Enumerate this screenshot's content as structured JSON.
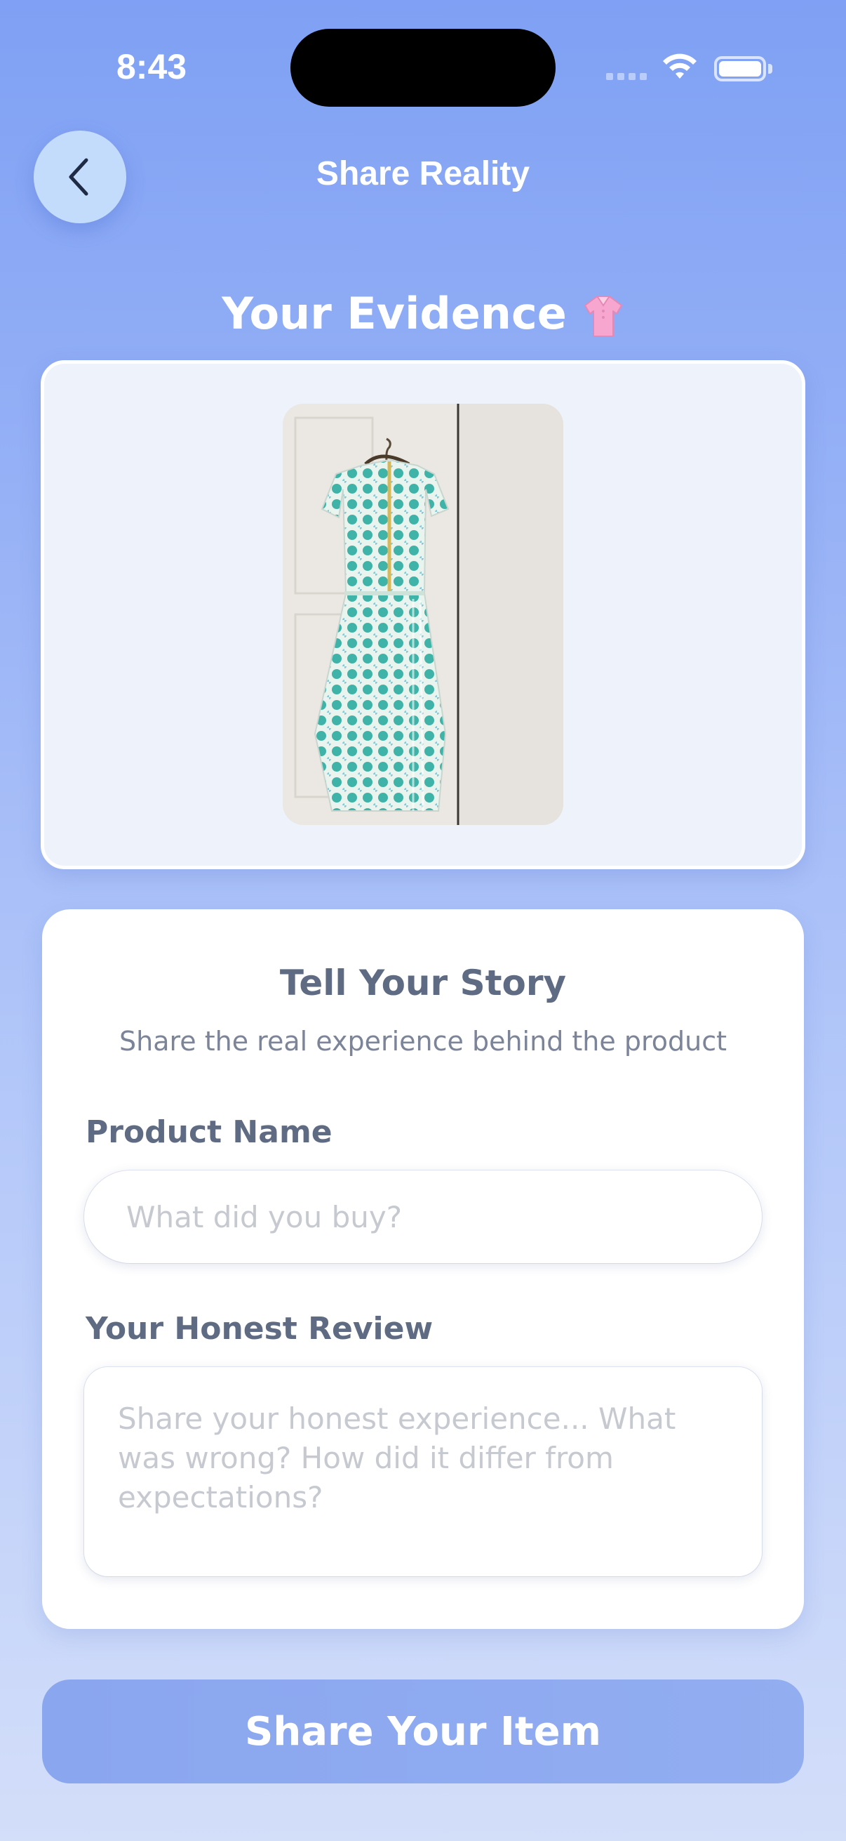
{
  "status_bar": {
    "time": "8:43",
    "icons": [
      "signal-icon",
      "wifi-icon",
      "battery-icon"
    ]
  },
  "header": {
    "title": "Share Reality",
    "back_icon": "chevron-left-icon"
  },
  "evidence": {
    "title": "Your Evidence",
    "title_icon": "shirt-icon",
    "photo_icon": "dress-photo"
  },
  "story": {
    "title": "Tell Your Story",
    "subtitle": "Share the real experience behind the product",
    "product_name_label": "Product Name",
    "product_name_placeholder": "What did you buy?",
    "product_name_value": "",
    "review_label": "Your Honest Review",
    "review_placeholder": "Share your honest experience... What was wrong? How did it differ from expectations?",
    "review_value": ""
  },
  "action": {
    "share_label": "Share Your Item"
  },
  "colors": {
    "background_top": "#7fa0f4",
    "background_bottom": "#d3def9",
    "text_primary": "#5f6b83",
    "button": "#8aa6ef"
  }
}
